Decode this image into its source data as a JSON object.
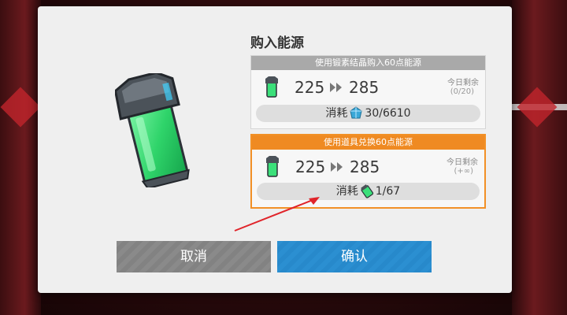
{
  "dialog": {
    "title": "购入能源",
    "crystal_option": {
      "header": "使用锻素结晶购入60点能源",
      "from": "225",
      "to": "285",
      "remain_label": "今日剩余",
      "remain_count": "(0/20)",
      "cost_label": "消耗",
      "cost_value": "30/6610",
      "cost_icon": "crystal-icon"
    },
    "item_option": {
      "header": "使用道具兑换60点能源",
      "from": "225",
      "to": "285",
      "remain_label": "今日剩余",
      "remain_count": "(+∞)",
      "cost_label": "消耗",
      "cost_value": "1/67",
      "cost_icon": "battery-item-icon",
      "selected": true
    },
    "buttons": {
      "cancel": "取消",
      "confirm": "确认"
    }
  },
  "colors": {
    "accent_orange": "#ef8a22",
    "confirm_blue": "#2b8fd1",
    "cancel_gray": "#8a8a8a",
    "energy_green": "#3be07a"
  }
}
